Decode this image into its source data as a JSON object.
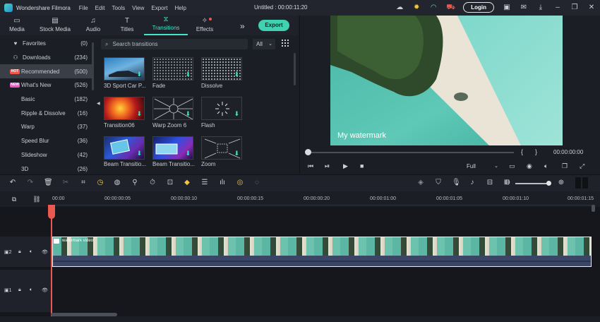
{
  "app": {
    "name": "Wondershare Filmora",
    "title": "Untitled : 00:00:11:20",
    "menu": [
      "File",
      "Edit",
      "Tools",
      "View",
      "Export",
      "Help"
    ],
    "login_label": "Login"
  },
  "library": {
    "tabs": [
      {
        "label": "Media",
        "icon": "folder-icon"
      },
      {
        "label": "Stock Media",
        "icon": "stock-media-icon"
      },
      {
        "label": "Audio",
        "icon": "music-icon"
      },
      {
        "label": "Titles",
        "icon": "text-icon"
      },
      {
        "label": "Transitions",
        "icon": "transitions-icon",
        "active": true
      },
      {
        "label": "Effects",
        "icon": "effects-icon",
        "has_dot": true
      }
    ],
    "export_label": "Export"
  },
  "sidebar": {
    "items": [
      {
        "label": "Favorites",
        "count": "(0)",
        "icon": "heart-icon"
      },
      {
        "label": "Downloads",
        "count": "(234)",
        "icon": "user-icon"
      },
      {
        "label": "Recommended",
        "count": "(500)",
        "badge": "HOT",
        "selected": true
      },
      {
        "label": "What's New",
        "count": "(526)",
        "badge": "NEW"
      },
      {
        "label": "Basic",
        "count": "(182)"
      },
      {
        "label": "Ripple & Dissolve",
        "count": "(16)"
      },
      {
        "label": "Warp",
        "count": "(37)"
      },
      {
        "label": "Speed Blur",
        "count": "(36)"
      },
      {
        "label": "Slideshow",
        "count": "(42)"
      },
      {
        "label": "3D",
        "count": "(26)"
      }
    ]
  },
  "search": {
    "placeholder": "Search transitions",
    "filter": "All"
  },
  "transitions": [
    {
      "label": "3D Sport Car P..."
    },
    {
      "label": "Fade"
    },
    {
      "label": "Dissolve"
    },
    {
      "label": "Transition06"
    },
    {
      "label": "Warp Zoom 6"
    },
    {
      "label": "Flash"
    },
    {
      "label": "Beam Transitio..."
    },
    {
      "label": "Beam Transitio..."
    },
    {
      "label": "Zoom"
    }
  ],
  "preview": {
    "watermark": "My watermark",
    "brace_open": "{",
    "brace_close": "}",
    "timecode": "00:00:00:00",
    "zoom": "Full"
  },
  "timeline": {
    "ruler": [
      "00:00",
      "00:00:00:05",
      "00:00:00:10",
      "00:00:00:15",
      "00:00:00:20",
      "00:00:01:00",
      "00:00:01:05",
      "00:00:01:10",
      "00:00:01:15"
    ],
    "clip_label": "watermark video",
    "tracks": [
      {
        "number": "2"
      },
      {
        "number": "1"
      }
    ]
  }
}
